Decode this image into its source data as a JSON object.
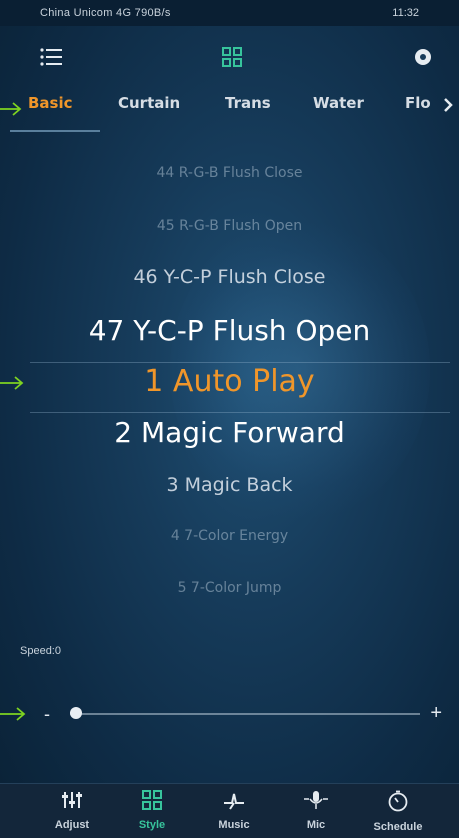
{
  "status_bar": {
    "left_text": "China Unicom 4G 790B/s",
    "right_text": "11:32"
  },
  "top_bar": {
    "menu_icon": "menu-icon",
    "center_icon": "grid-icon",
    "right_icon": "record-icon"
  },
  "tabs": [
    "Basic",
    "Curtain",
    "Trans",
    "Water",
    "Flo"
  ],
  "active_tab": "Basic",
  "modes": [
    "44 R-G-B Flush Close",
    "45 R-G-B Flush Open",
    "46 Y-C-P Flush Close",
    "47 Y-C-P Flush Open",
    "1 Auto Play",
    "2 Magic Forward",
    "3 Magic Back",
    "4 7-Color Energy",
    "5 7-Color Jump"
  ],
  "selected_mode": "1 Auto Play",
  "speed": {
    "label": "Speed:0",
    "minus": "-",
    "plus": "+",
    "value_fraction": 0.0
  },
  "bottom_nav": [
    {
      "label": "Adjust",
      "icon": "sliders-icon"
    },
    {
      "label": "Style",
      "icon": "grid-icon"
    },
    {
      "label": "Music",
      "icon": "music-icon"
    },
    {
      "label": "Mic",
      "icon": "mic-icon"
    },
    {
      "label": "Schedule",
      "icon": "timer-icon"
    }
  ],
  "colors": {
    "accent_orange": "#f0962a",
    "accent_green": "#37c49c",
    "annotation_arrow": "#7ed321"
  }
}
